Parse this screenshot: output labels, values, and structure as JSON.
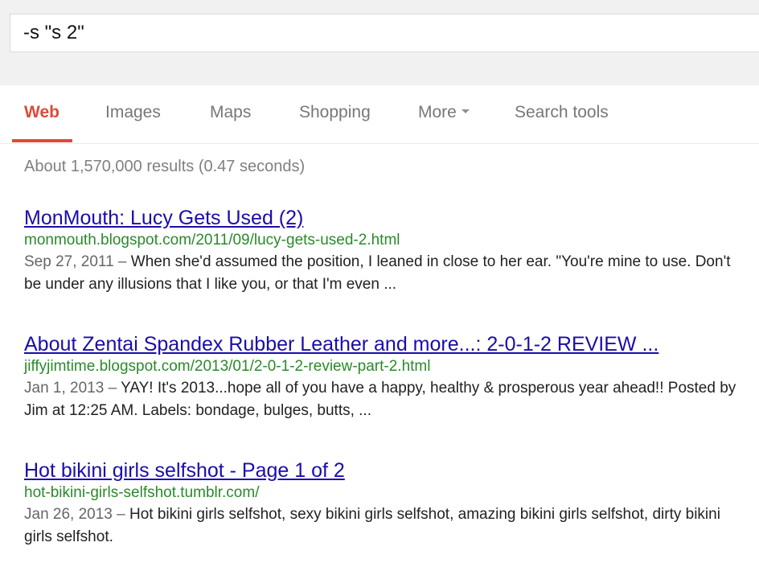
{
  "search": {
    "query": "-s \"s 2\""
  },
  "tabs": [
    {
      "label": "Web",
      "active": true
    },
    {
      "label": "Images"
    },
    {
      "label": "Maps"
    },
    {
      "label": "Shopping"
    },
    {
      "label": "More"
    },
    {
      "label": "Search tools"
    }
  ],
  "stats": "About 1,570,000 results (0.47 seconds)",
  "results": [
    {
      "title": "MonMouth: Lucy Gets Used (2)",
      "url": "monmouth.blogspot.com/2011/09/lucy-gets-used-2.html",
      "date": "Sep 27, 2011 – ",
      "snippet": "When she'd assumed the position, I leaned in close to her ear. \"You're mine to use. Don't be under any illusions that I like you, or that I'm even ..."
    },
    {
      "title": "About Zentai Spandex Rubber Leather and more...: 2-0-1-2 REVIEW ...",
      "url": "jiffyjimtime.blogspot.com/2013/01/2-0-1-2-review-part-2.html",
      "date": "Jan 1, 2013 – ",
      "snippet": "YAY! It's 2013...hope all of you have a happy, healthy & prosperous year ahead!! Posted by Jim at 12:25 AM. Labels: bondage, bulges, butts, ..."
    },
    {
      "title": "Hot bikini girls selfshot - Page 1 of 2",
      "url": "hot-bikini-girls-selfshot.tumblr.com/",
      "date": "Jan 26, 2013 – ",
      "snippet": "Hot bikini girls selfshot, sexy bikini girls selfshot, amazing bikini girls selfshot, dirty bikini girls selfshot."
    }
  ],
  "colors": {
    "active_tab": "#dd4b39",
    "link": "#1a0dab",
    "url": "#2a8a2a"
  },
  "icons": {
    "more_caret": "chevron-down-icon"
  }
}
